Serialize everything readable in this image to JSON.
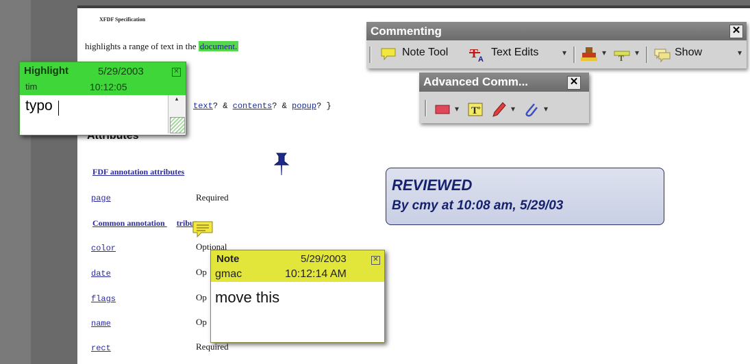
{
  "document": {
    "header": "XFDF Specification",
    "line_before": "highlights a range of text in the ",
    "highlighted_word": "document.",
    "code_line": {
      "word1": "text",
      "mid1": "? & ",
      "word2": "contents",
      "mid2": "? & ",
      "word3": "popup",
      "tail": "? }"
    },
    "attributes_heading": "Attributes",
    "fdf_link": "FDF annotation attributes",
    "common_link_start": "Common annotation ",
    "common_link_end": "tributes",
    "rows": [
      {
        "name": "page",
        "value": "Required"
      },
      {
        "name": "color",
        "value": "Optional"
      },
      {
        "name": "date",
        "value": "Op"
      },
      {
        "name": "flags",
        "value": "Op"
      },
      {
        "name": "name",
        "value": "Op"
      },
      {
        "name": "rect",
        "value": "Required"
      }
    ]
  },
  "highlight_popup": {
    "title": "Highlight",
    "date": "5/29/2003",
    "author": "tim",
    "time": "10:12:05",
    "text": "typo",
    "close_glyph": "✕",
    "color": "#3fd63a"
  },
  "commenting_toolbar": {
    "title": "Commenting",
    "close_glyph": "✕",
    "note_tool": "Note Tool",
    "text_edits": "Text Edits",
    "show": "Show",
    "dropdown_glyph": "▾"
  },
  "advanced_toolbar": {
    "title": "Advanced Comm...",
    "close_glyph": "✕",
    "dropdown_glyph": "▾"
  },
  "stamp": {
    "line1": "REVIEWED",
    "line2": "By cmy at 10:08 am, 5/29/03"
  },
  "note_popup": {
    "title": "Note",
    "date": "5/29/2003",
    "author": "gmac",
    "time": "10:12:14 AM",
    "text": "move this",
    "close_glyph": "✕",
    "color": "#e3e63a"
  }
}
